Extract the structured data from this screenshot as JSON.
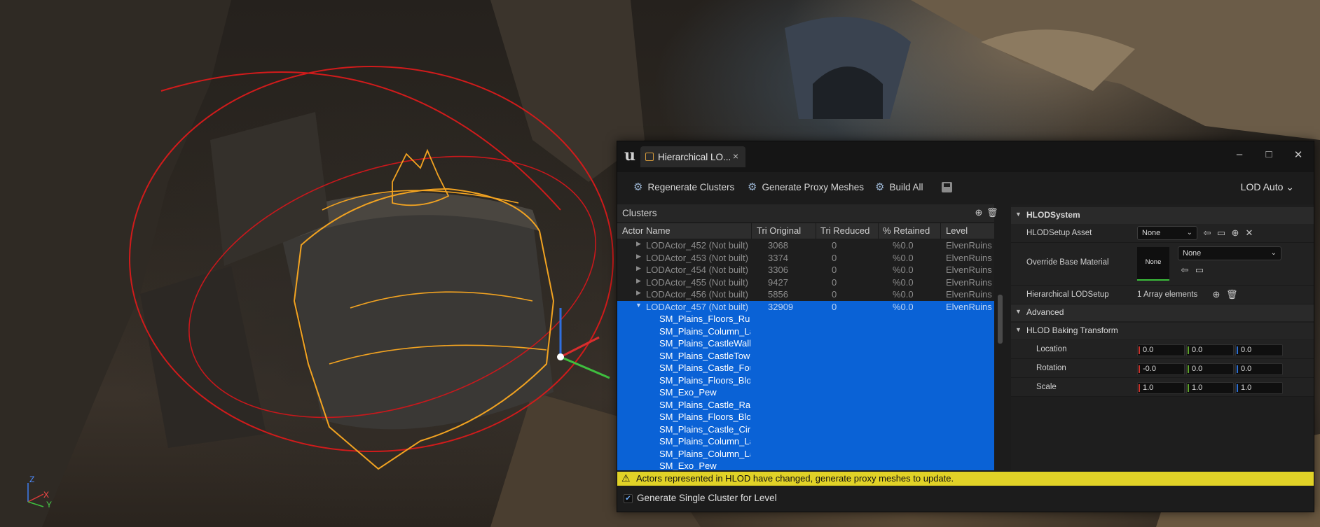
{
  "window": {
    "tab_title": "Hierarchical LO...",
    "tab_close": "×",
    "minimize": "–",
    "maximize": "□",
    "close": "✕"
  },
  "toolbar": {
    "regenerate_label": "Regenerate Clusters",
    "generate_proxy_label": "Generate Proxy Meshes",
    "build_all_label": "Build All",
    "lod_mode": "LOD Auto ⌄"
  },
  "clusters": {
    "title": "Clusters",
    "columns": [
      "Actor Name",
      "Tri Original",
      "Tri Reduced",
      "% Retained",
      "Level"
    ],
    "actors": [
      {
        "name": "LODActor_452 (Not built)",
        "tri_original": "3068",
        "tri_reduced": "0",
        "retained": "%0.0",
        "level": "ElvenRuins"
      },
      {
        "name": "LODActor_453 (Not built)",
        "tri_original": "3374",
        "tri_reduced": "0",
        "retained": "%0.0",
        "level": "ElvenRuins"
      },
      {
        "name": "LODActor_454 (Not built)",
        "tri_original": "3306",
        "tri_reduced": "0",
        "retained": "%0.0",
        "level": "ElvenRuins"
      },
      {
        "name": "LODActor_455 (Not built)",
        "tri_original": "9427",
        "tri_reduced": "0",
        "retained": "%0.0",
        "level": "ElvenRuins"
      },
      {
        "name": "LODActor_456 (Not built)",
        "tri_original": "5856",
        "tri_reduced": "0",
        "retained": "%0.0",
        "level": "ElvenRuins"
      },
      {
        "name": "LODActor_457 (Not built)",
        "tri_original": "32909",
        "tri_reduced": "0",
        "retained": "%0.0",
        "level": "ElvenRuins"
      }
    ],
    "children": [
      "SM_Plains_Floors_Rubl",
      "SM_Plains_Column_La",
      "SM_Plains_CastleWall_",
      "SM_Plains_CastleTowe",
      "SM_Plains_Castle_Four",
      "SM_Plains_Floors_Bloc",
      "SM_Exo_Pew",
      "SM_Plains_Castle_Rail",
      "SM_Plains_Floors_Bloc",
      "SM_Plains_Castle_Circ",
      "SM_Plains_Column_La",
      "SM_Plains_Column_La",
      "SM_Exo_Pew"
    ]
  },
  "details": {
    "hlod_system": "HLODSystem",
    "setup_asset_label": "HLODSetup Asset",
    "setup_asset_value": "None",
    "override_label": "Override Base Material",
    "override_swatch": "None",
    "override_value": "None",
    "lodsetup_label": "Hierarchical LODSetup",
    "lodsetup_value": "1 Array elements",
    "advanced": "Advanced",
    "baking": "HLOD Baking Transform",
    "location_label": "Location",
    "rotation_label": "Rotation",
    "scale_label": "Scale",
    "location": [
      "0.0",
      "0.0",
      "0.0"
    ],
    "rotation": [
      "-0.0",
      "0.0",
      "0.0"
    ],
    "scale": [
      "1.0",
      "1.0",
      "1.0"
    ],
    "axis_colors": [
      "#c8332b",
      "#5fa32b",
      "#2d6fd1"
    ]
  },
  "warning": "Actors represented in HLOD have changed, generate proxy meshes to update.",
  "footer": {
    "checkbox_checked": true,
    "checkbox_label": "Generate Single Cluster for Level"
  },
  "viewport_axes": {
    "z": "Z",
    "x": "X",
    "y": "Y"
  }
}
